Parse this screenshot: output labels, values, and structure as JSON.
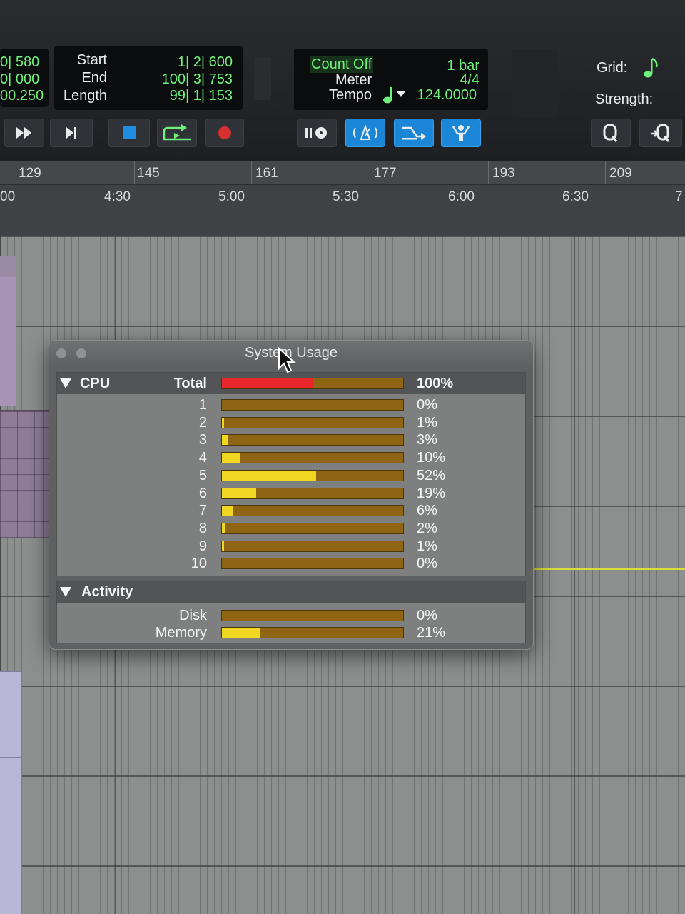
{
  "transport": {
    "counter_left": [
      "0| 580",
      "0| 000",
      "00.250"
    ],
    "range_labels": [
      "Start",
      "End",
      "Length"
    ],
    "range_values": [
      "1| 2| 600",
      "100| 3| 753",
      "99| 1| 153"
    ],
    "count_off": "Count Off",
    "meter_label": "Meter",
    "tempo_label": "Tempo",
    "count_off_value": "1 bar",
    "meter_value": "4/4",
    "tempo_value": "124.0000",
    "grid_label": "Grid:",
    "strength_label": "Strength:"
  },
  "ruler": {
    "bars": [
      "129",
      "145",
      "161",
      "177",
      "193",
      "209"
    ],
    "minutes": [
      "00",
      "4:30",
      "5:00",
      "5:30",
      "6:00",
      "6:30",
      "7"
    ]
  },
  "system_usage": {
    "title": "System Usage",
    "cpu": {
      "header": "CPU",
      "total_label": "Total",
      "total_percent": 100,
      "total_percent_label": "100%",
      "cores": [
        {
          "label": "1",
          "percent": 0,
          "percent_label": "0%"
        },
        {
          "label": "2",
          "percent": 1,
          "percent_label": "1%"
        },
        {
          "label": "3",
          "percent": 3,
          "percent_label": "3%"
        },
        {
          "label": "4",
          "percent": 10,
          "percent_label": "10%"
        },
        {
          "label": "5",
          "percent": 52,
          "percent_label": "52%"
        },
        {
          "label": "6",
          "percent": 19,
          "percent_label": "19%"
        },
        {
          "label": "7",
          "percent": 6,
          "percent_label": "6%"
        },
        {
          "label": "8",
          "percent": 2,
          "percent_label": "2%"
        },
        {
          "label": "9",
          "percent": 1,
          "percent_label": "1%"
        },
        {
          "label": "10",
          "percent": 0,
          "percent_label": "0%"
        }
      ]
    },
    "activity": {
      "header": "Activity",
      "items": [
        {
          "label": "Disk",
          "percent": 0,
          "percent_label": "0%"
        },
        {
          "label": "Memory",
          "percent": 21,
          "percent_label": "21%"
        }
      ]
    }
  },
  "colors": {
    "counter_green": "#6ff07a",
    "meter_track": "#8f6412",
    "meter_fill": "#f1d722",
    "meter_total_fill": "#e8262a",
    "button_blue": "#1b86d6"
  }
}
